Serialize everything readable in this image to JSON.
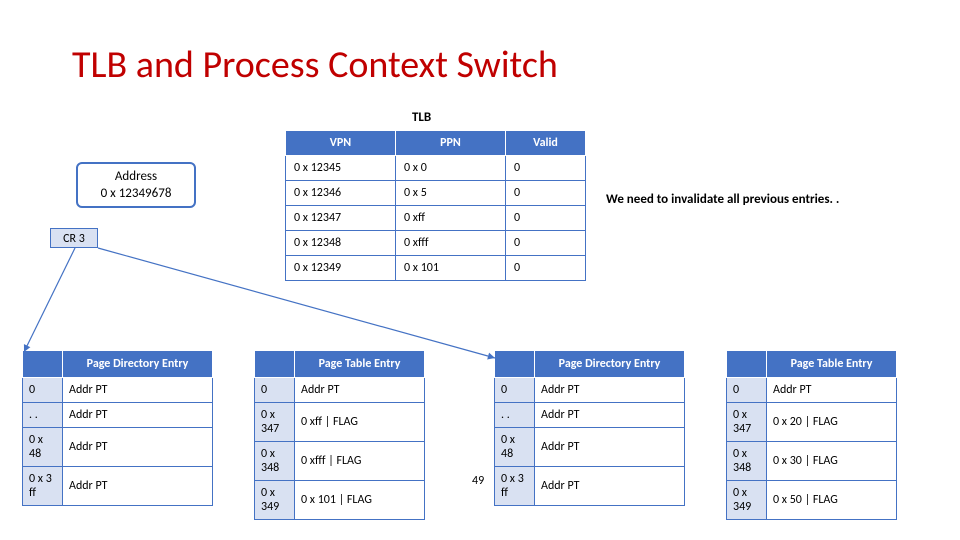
{
  "title": "TLB and Process Context Switch",
  "tlb_caption": "TLB",
  "address_box": {
    "line1": "Address",
    "line2": "0 x 12349678"
  },
  "cr3": "CR 3",
  "note": "We need to invalidate all previous entries. .",
  "page_number": "49",
  "tlb": {
    "headers": {
      "vpn": "VPN",
      "ppn": "PPN",
      "valid": "Valid"
    },
    "rows": [
      {
        "vpn": "0 x 12345",
        "ppn": "0 x 0",
        "valid": "0"
      },
      {
        "vpn": "0 x 12346",
        "ppn": "0 x 5",
        "valid": "0"
      },
      {
        "vpn": "0 x 12347",
        "ppn": "0 xff",
        "valid": "0"
      },
      {
        "vpn": "0 x 12348",
        "ppn": "0 xfff",
        "valid": "0"
      },
      {
        "vpn": "0 x 12349",
        "ppn": "0 x 101",
        "valid": "0"
      }
    ]
  },
  "pde1": {
    "header": "Page Directory Entry",
    "rows": [
      {
        "idx": "0",
        "val": "Addr PT"
      },
      {
        "idx": ". .",
        "val": "Addr PT"
      },
      {
        "idx": "0 x 48",
        "val": "Addr PT"
      },
      {
        "idx": "0 x 3 ff",
        "val": "Addr PT"
      }
    ]
  },
  "pte1": {
    "header": "Page Table Entry",
    "rows": [
      {
        "idx": "0",
        "val": "Addr PT"
      },
      {
        "idx": "0 x 347",
        "val": "0 xff | FLAG"
      },
      {
        "idx": "0 x 348",
        "val": "0 xfff | FLAG"
      },
      {
        "idx": "0 x 349",
        "val": "0 x 101 | FLAG"
      }
    ]
  },
  "pde2": {
    "header": "Page Directory Entry",
    "rows": [
      {
        "idx": "0",
        "val": "Addr PT"
      },
      {
        "idx": ". .",
        "val": "Addr PT"
      },
      {
        "idx": "0 x 48",
        "val": "Addr PT"
      },
      {
        "idx": "0 x 3 ff",
        "val": "Addr PT"
      }
    ]
  },
  "pte2": {
    "header": "Page Table Entry",
    "rows": [
      {
        "idx": "0",
        "val": "Addr PT"
      },
      {
        "idx": "0 x 347",
        "val": "0 x 20 | FLAG"
      },
      {
        "idx": "0 x 348",
        "val": "0 x 30 | FLAG"
      },
      {
        "idx": "0 x 349",
        "val": "0 x 50 | FLAG"
      }
    ]
  }
}
